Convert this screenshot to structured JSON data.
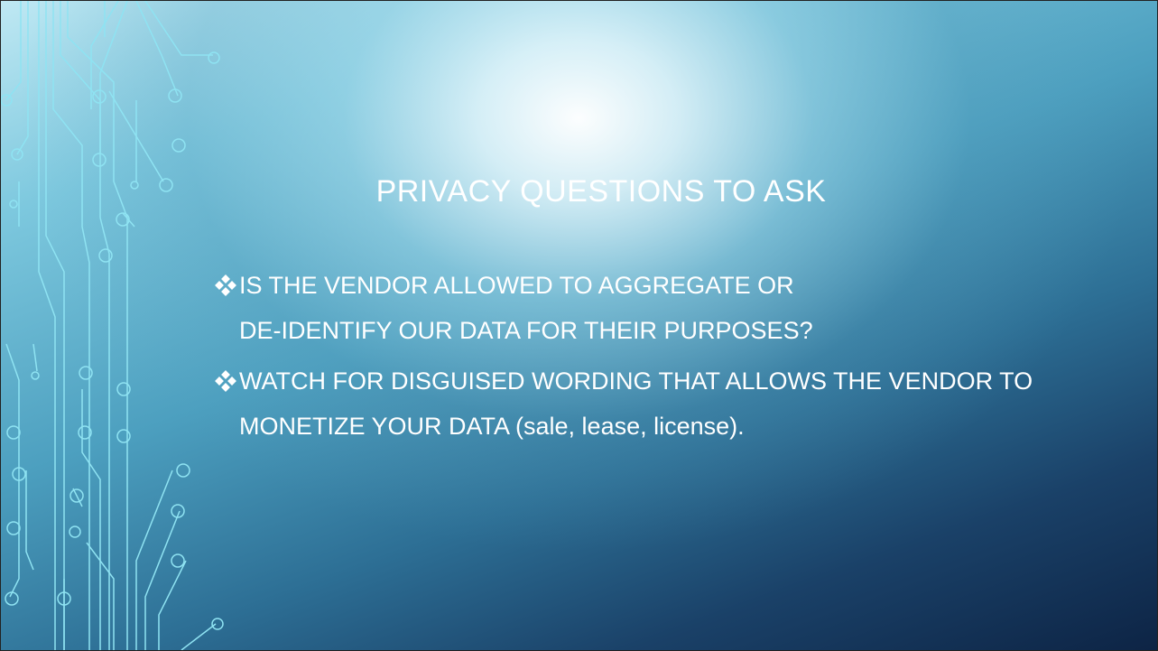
{
  "slide": {
    "title": "PRIVACY QUESTIONS TO ASK",
    "bullets": [
      {
        "text": "IS THE VENDOR ALLOWED TO AGGREGATE OR DE-IDENTIFY OUR DATA FOR THEIR PURPOSES?"
      },
      {
        "text": "WATCH FOR DISGUISED WORDING THAT ALLOWS THE VENDOR TO MONETIZE YOUR DATA (sale, lease, license)."
      }
    ],
    "bullet_icon": "diamond-star-bullet",
    "decoration_icon": "circuit-lines",
    "colors": {
      "text": "#ffffff",
      "bg_top": "#bfe8f3",
      "bg_bottom": "#0d2445",
      "circuit": "#8fe3f2"
    }
  }
}
